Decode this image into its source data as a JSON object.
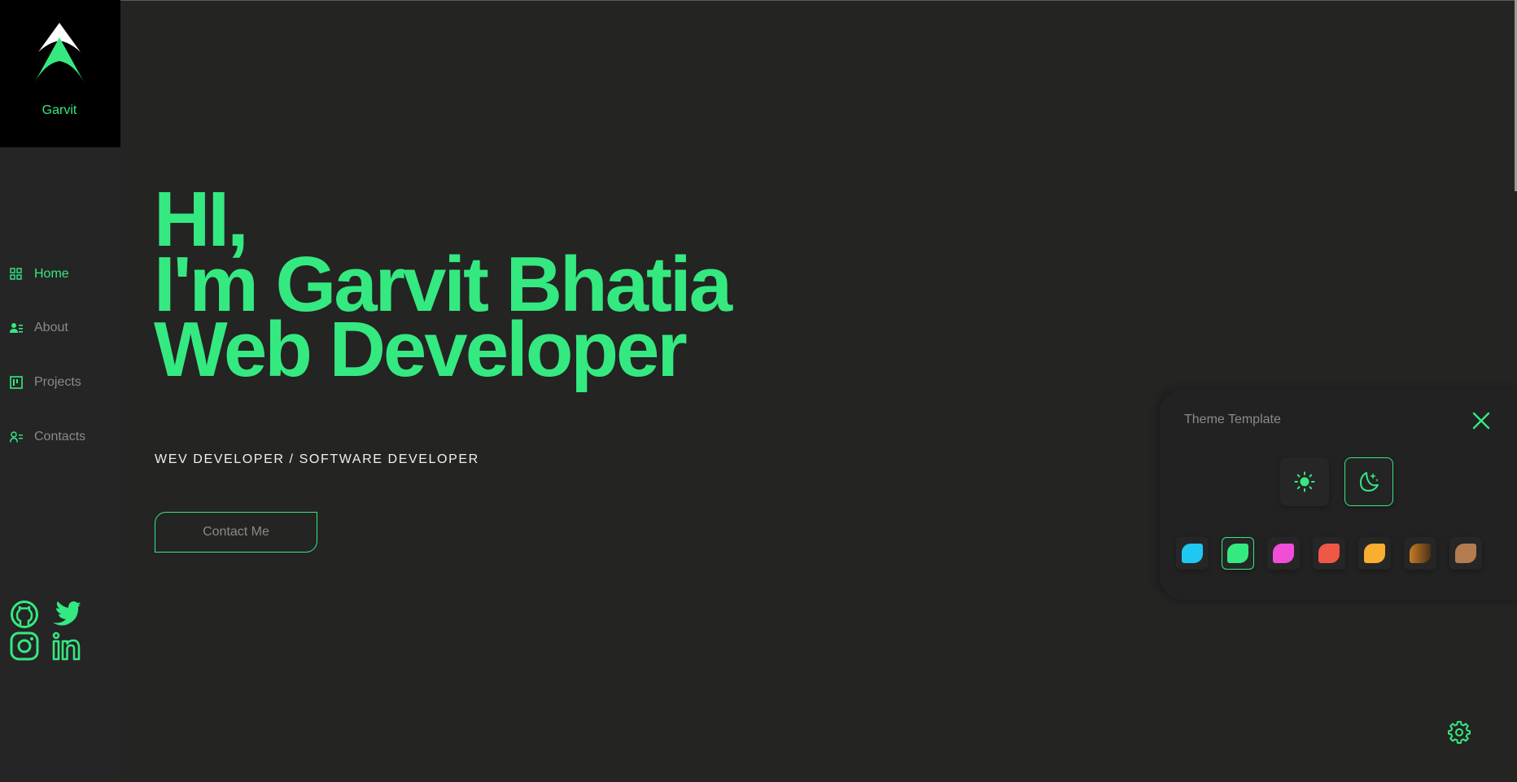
{
  "brand": {
    "name": "Garvit"
  },
  "nav": {
    "items": [
      {
        "label": "Home",
        "icon": "grid-icon",
        "active": true
      },
      {
        "label": "About",
        "icon": "user-card-icon",
        "active": false
      },
      {
        "label": "Projects",
        "icon": "kanban-icon",
        "active": false
      },
      {
        "label": "Contacts",
        "icon": "contacts-icon",
        "active": false
      }
    ]
  },
  "socials": [
    {
      "name": "github-icon"
    },
    {
      "name": "twitter-icon"
    },
    {
      "name": "instagram-icon"
    },
    {
      "name": "linkedin-icon"
    }
  ],
  "hero": {
    "line1": "HI,",
    "line2": "I'm Garvit Bhatia",
    "line3": "Web Developer",
    "subtitle": "WEV DEVELOPER / SOFTWARE DEVELOPER",
    "cta": "Contact Me"
  },
  "theme_panel": {
    "title": "Theme Template",
    "modes": [
      {
        "name": "sun-icon",
        "selected": false
      },
      {
        "name": "moon-stars-icon",
        "selected": true
      }
    ],
    "swatches": [
      {
        "color": "#1ec8f0",
        "selected": false
      },
      {
        "color": "#35e981",
        "selected": true
      },
      {
        "color": "#f04ed6",
        "selected": false
      },
      {
        "color": "#ef5846",
        "selected": false
      },
      {
        "color": "#f8ae2e",
        "selected": false
      },
      {
        "color": "#c87a22",
        "selected": false
      },
      {
        "color": "#b27c4f",
        "selected": false
      }
    ]
  },
  "colors": {
    "accent": "#35e981",
    "background": "#242423",
    "logo_bg": "#000000"
  }
}
